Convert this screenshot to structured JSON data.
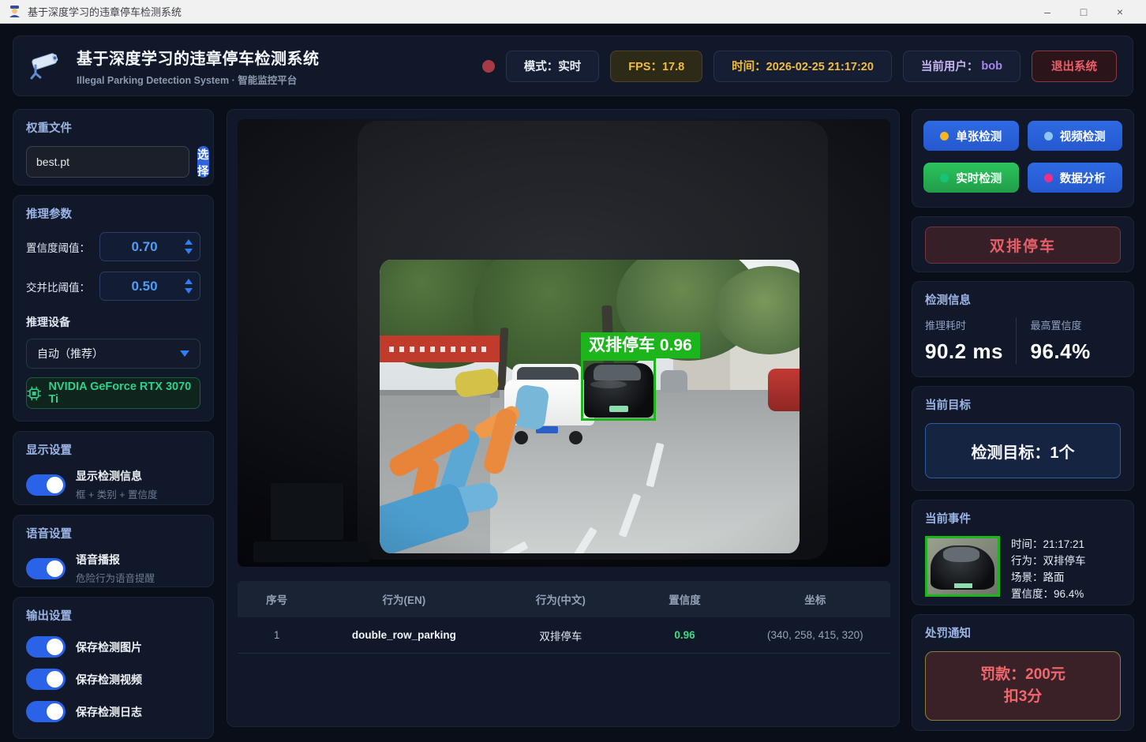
{
  "window": {
    "title": "基于深度学习的违章停车检测系统",
    "minimize": "–",
    "maximize": "□",
    "close": "×"
  },
  "header": {
    "title": "基于深度学习的违章停车检测系统",
    "subtitle": "Illegal Parking Detection System · 智能监控平台",
    "mode_badge": "模式：实时",
    "fps_badge": "FPS：17.8",
    "time_badge": "时间：2026-02-25 21:17:20",
    "user_label": "当前用户：",
    "user_name": "bob",
    "exit_button": "退出系统"
  },
  "sidebar_left": {
    "weight": {
      "title": "权重文件",
      "file_value": "best.pt",
      "select_button": "选择"
    },
    "params": {
      "title": "推理参数",
      "conf_label": "置信度阈值：",
      "conf_value": "0.70",
      "iou_label": "交并比阈值：",
      "iou_value": "0.50"
    },
    "device": {
      "title": "推理设备",
      "selected": "自动（推荐）",
      "gpu": "NVIDIA GeForce RTX 3070 Ti"
    },
    "display": {
      "title": "显示设置",
      "toggle_label": "显示检测信息",
      "toggle_sub": "框 + 类别 + 置信度",
      "enabled": true
    },
    "voice": {
      "title": "语音设置",
      "toggle_label": "语音播报",
      "toggle_sub": "危险行为语音提醒",
      "enabled": true
    },
    "output": {
      "title": "输出设置",
      "toggles": [
        {
          "label": "保存检测图片",
          "enabled": true
        },
        {
          "label": "保存检测视频",
          "enabled": true
        },
        {
          "label": "保存检测日志",
          "enabled": true
        }
      ]
    }
  },
  "main": {
    "detection_label": "双排停车 0.96",
    "table": {
      "headers": [
        "序号",
        "行为(EN)",
        "行为(中文)",
        "置信度",
        "坐标"
      ],
      "rows": [
        {
          "index": "1",
          "behavior_en": "double_row_parking",
          "behavior_cn": "双排停车",
          "confidence": "0.96",
          "coords": "(340, 258, 415, 320)"
        }
      ]
    }
  },
  "sidebar_right": {
    "modes": [
      {
        "label": "单张检测",
        "dot_color": "#f7b620",
        "active": false
      },
      {
        "label": "视频检测",
        "dot_color": "#8ec6f5",
        "active": false
      },
      {
        "label": "实时检测",
        "dot_color": "#17c27a",
        "active": true
      },
      {
        "label": "数据分析",
        "dot_color": "#ef2f86",
        "active": false
      }
    ],
    "alert_label": "双排停车",
    "info": {
      "title": "检测信息",
      "time_label": "推理耗时",
      "time_value": "90.2 ms",
      "conf_label": "最高置信度",
      "conf_value": "96.4%"
    },
    "target": {
      "title": "当前目标",
      "value": "检测目标：1个"
    },
    "event": {
      "title": "当前事件",
      "time": "时间：21:17:21",
      "behavior": "行为：双排停车",
      "scene": "场景：路面",
      "confidence": "置信度：96.4%"
    },
    "penalty": {
      "title": "处罚通知",
      "line1": "罚款：200元",
      "line2": "扣3分"
    }
  },
  "colors": {
    "accent_blue": "#2d63de",
    "success_green": "#22ad52",
    "detection_green": "#1cb51c",
    "danger_red": "#ee5f68",
    "warning_yellow": "#f2bc3f",
    "user_purple": "#a886ee",
    "value_blue": "#4d9ef8",
    "gpu_green": "#2fd08d",
    "confidence_green": "#3ddc84",
    "alert_red": "#e75f68",
    "penalty_border": "#89803f"
  }
}
